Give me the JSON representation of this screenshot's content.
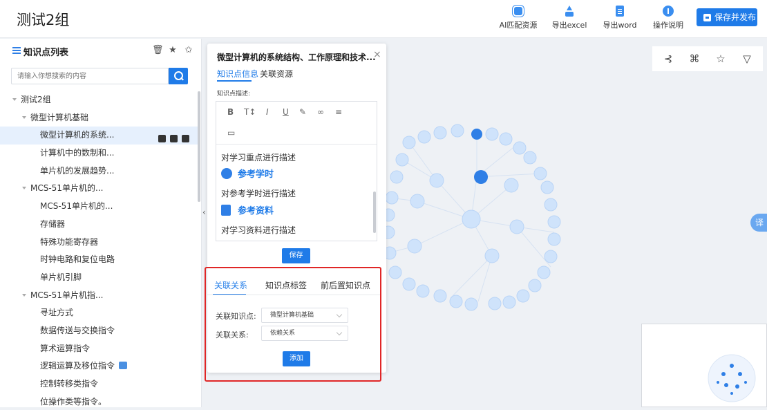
{
  "header": {
    "title": "测试2组",
    "tools": [
      {
        "label": "AI匹配资源",
        "icon": "cpu-icon"
      },
      {
        "label": "导出excel",
        "icon": "upload-icon"
      },
      {
        "label": "导出word",
        "icon": "document-icon"
      },
      {
        "label": "操作说明",
        "icon": "info-icon"
      }
    ],
    "save_publish_label": "保存并发布"
  },
  "sidebar": {
    "title": "知识点列表",
    "search_placeholder": "请输入你想搜索的内容",
    "tree": [
      {
        "label": "测试2组",
        "level": 0,
        "expanded": true
      },
      {
        "label": "微型计算机基础",
        "level": 1,
        "expanded": true
      },
      {
        "label": "微型计算机的系统...",
        "level": 2,
        "selected": true
      },
      {
        "label": "计算机中的数制和...",
        "level": 2
      },
      {
        "label": "单片机的发展趋势...",
        "level": 2
      },
      {
        "label": "MCS-51单片机的...",
        "level": 1,
        "expanded": true
      },
      {
        "label": "MCS-51单片机的...",
        "level": 2
      },
      {
        "label": "存储器",
        "level": 2
      },
      {
        "label": "特殊功能寄存器",
        "level": 2
      },
      {
        "label": "时钟电路和复位电路",
        "level": 2
      },
      {
        "label": "单片机引脚",
        "level": 2
      },
      {
        "label": "MCS-51单片机指...",
        "level": 1,
        "expanded": true
      },
      {
        "label": "寻址方式",
        "level": 2
      },
      {
        "label": "数据传送与交换指令",
        "level": 2
      },
      {
        "label": "算术运算指令",
        "level": 2
      },
      {
        "label": "逻辑运算及移位指令",
        "level": 2,
        "badge": true
      },
      {
        "label": "控制转移类指令",
        "level": 2
      },
      {
        "label": "位操作类等指令。",
        "level": 2
      }
    ]
  },
  "panel": {
    "title": "微型计算机的系统结构、工作原理和技术...",
    "close": "×",
    "tabs": [
      "知识点信息",
      "关联资源"
    ],
    "desc_label": "知识点描述:",
    "editor_lines": {
      "line1": "对学习重点进行描述",
      "head1": "参考学时",
      "line2": "对参考学时进行描述",
      "head2": "参考资料",
      "line3": "对学习资料进行描述"
    },
    "save_label": "保存",
    "rel_tabs": [
      "关联关系",
      "知识点标签",
      "前后置知识点"
    ],
    "rel_kp_label": "关联知识点:",
    "rel_kp_value": "微型计算机基础",
    "rel_type_label": "关联关系:",
    "rel_type_value": "依赖关系",
    "add_label": "添加"
  },
  "float_button": "译",
  "colors": {
    "accent": "#1f7be8",
    "highlight": "#e02626",
    "node": "#cfe3fb"
  }
}
